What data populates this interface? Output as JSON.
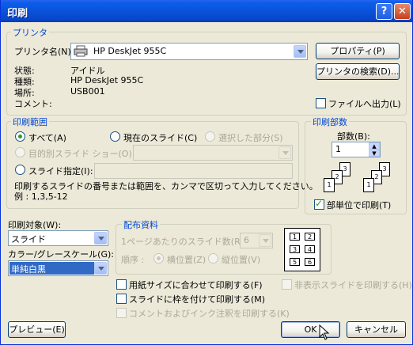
{
  "window": {
    "title": "印刷",
    "help_glyph": "?",
    "close_glyph": "✕"
  },
  "printer": {
    "legend": "プリンタ",
    "name_label": "プリンタ名(N):",
    "name_value": "HP DeskJet 955C",
    "properties_button": "プロパティ(P)",
    "find_button": "プリンタの検索(D)...",
    "status_label": "状態:",
    "status_value": "アイドル",
    "type_label": "種類:",
    "type_value": "HP DeskJet 955C",
    "location_label": "場所:",
    "location_value": "USB001",
    "comment_label": "コメント:",
    "print_to_file": "ファイルへ出力(L)",
    "print_to_file_checked": false
  },
  "range": {
    "legend": "印刷範囲",
    "all": "すべて(A)",
    "current": "現在のスライド(C)",
    "selection": "選択した部分(S)",
    "custom_show": "目的別スライド ショー(O):",
    "slides": "スライド指定(I):",
    "selected_option": "all",
    "help": "印刷するスライドの番号または範囲を、カンマで区切って入力してください。",
    "example": "例 : 1,3,5-12"
  },
  "copies": {
    "legend": "印刷部数",
    "count_label": "部数(B):",
    "count_value": "1",
    "collate": "部単位で印刷(T)",
    "collate_checked": true
  },
  "print_what": {
    "label": "印刷対象(W):",
    "value": "スライド"
  },
  "color": {
    "label": "カラー/グレースケール(G):",
    "value": "単純白黒"
  },
  "handouts": {
    "legend": "配布資料",
    "per_page_label": "1ページあたりのスライド数(R):",
    "per_page_value": "6",
    "order_label": "順序 :",
    "horizontal": "横位置(Z)",
    "vertical": "縦位置(V)",
    "layout_numbers": [
      "1",
      "2",
      "3",
      "4",
      "5",
      "6"
    ]
  },
  "options": {
    "scale_to_fit": "用紙サイズに合わせて印刷する(F)",
    "frame_slides": "スライドに枠を付けて印刷する(M)",
    "comments": "コメントおよびインク注釈を印刷する(K)",
    "hidden_slides": "非表示スライドを印刷する(H)"
  },
  "buttons": {
    "preview": "プレビュー(E)",
    "ok": "OK",
    "cancel": "キャンセル"
  }
}
